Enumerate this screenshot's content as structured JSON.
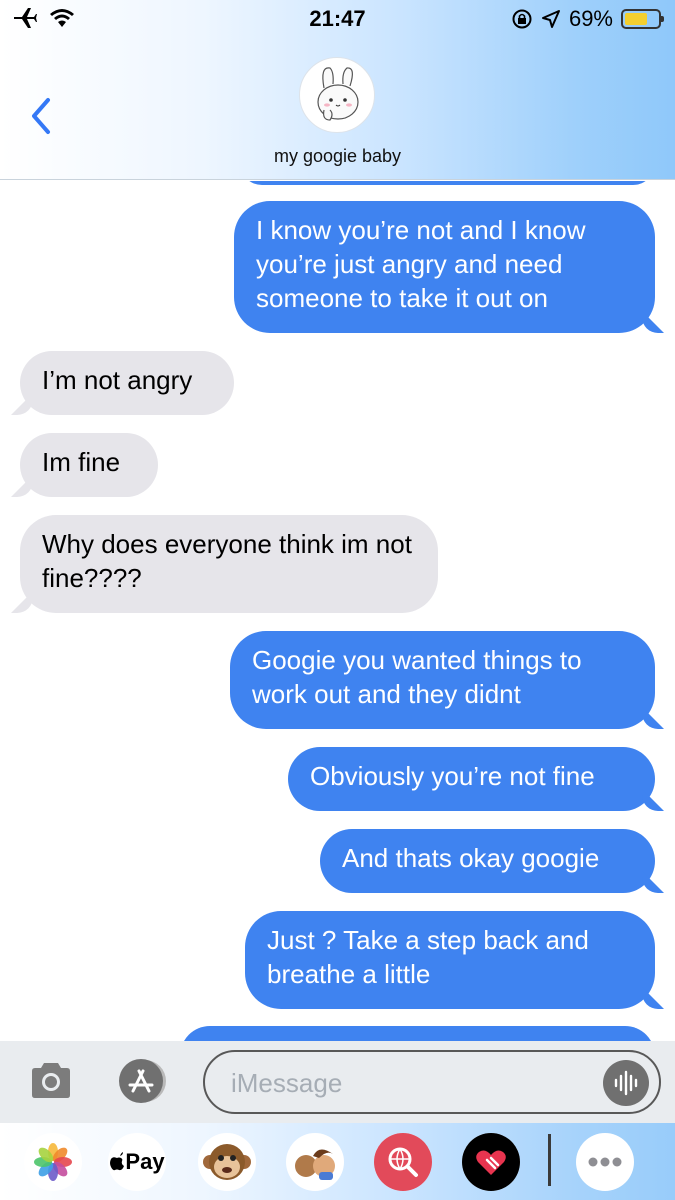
{
  "status_bar": {
    "time": "21:47",
    "battery": "69%"
  },
  "conversation": {
    "contact_name": "my googie baby"
  },
  "messages": [
    {
      "sender": "me",
      "text": "I know you’re not and I know you’re just angry and need someone to take it out on"
    },
    {
      "sender": "them",
      "text": "I’m not angry"
    },
    {
      "sender": "them",
      "text": "Im fine"
    },
    {
      "sender": "them",
      "text": "Why does everyone think im not fine????"
    },
    {
      "sender": "me",
      "text": "Googie you wanted things to work out and they didnt"
    },
    {
      "sender": "me",
      "text": "Obviously you’re not fine"
    },
    {
      "sender": "me",
      "text": "And thats okay googie"
    },
    {
      "sender": "me",
      "text": "Just ? Take a step back and breathe a little"
    }
  ],
  "composer": {
    "placeholder": "iMessage"
  },
  "apps": {
    "pay_label": "Pay"
  },
  "colors": {
    "outgoing_bubble": "#3f83f0",
    "incoming_bubble": "#e6e5ea",
    "battery_fill": "#f3cf2f"
  }
}
